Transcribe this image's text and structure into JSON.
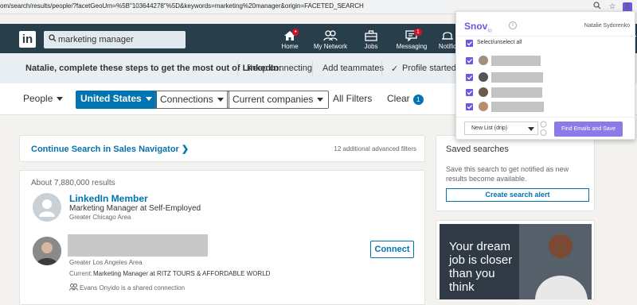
{
  "browser": {
    "url": "om/search/results/people/?facetGeoUrn=%5B\"103644278\"%5D&keywords=marketing%20manager&origin=FACETED_SEARCH",
    "icons": [
      "zoom-icon",
      "star-icon",
      "snovio-extension-icon"
    ],
    "ext_label": "S"
  },
  "nav": {
    "logo": "in",
    "search_value": "marketing manager",
    "items": [
      {
        "label": "Home",
        "badge": "•"
      },
      {
        "label": "My Network",
        "badge": ""
      },
      {
        "label": "Jobs",
        "badge": ""
      },
      {
        "label": "Messaging",
        "badge": "1"
      },
      {
        "label": "Notific",
        "badge": ""
      }
    ]
  },
  "steps": {
    "message": "Natalie, complete these steps to get the most out of LinkedIn:",
    "keep": "Keep connecting",
    "teammates": "Add teammates",
    "profile": "Profile started",
    "check": "✓"
  },
  "filters": {
    "people": "People",
    "country": "United States",
    "connections": "Connections",
    "companies": "Current companies",
    "all": "All Filters",
    "clear": "Clear",
    "clear_count": "1"
  },
  "sales_nav": {
    "link": "Continue Search in Sales Navigator ❯",
    "advanced": "12 additional advanced filters"
  },
  "results": {
    "count": "About 7,880,000 results",
    "items": [
      {
        "name": "LinkedIn Member",
        "headline": "Marketing Manager at Self-Employed",
        "location": "Greater Chicago Area"
      },
      {
        "location": "Greater Los Angeles Area",
        "current_prefix": "Current:",
        "current": "Marketing Manager at RITZ TOURS & AFFORDABLE WORLD",
        "shared": "Evans Onyido is a shared connection",
        "action": "Connect"
      }
    ]
  },
  "saved": {
    "title": "Saved searches",
    "text": "Save this search to get notified as new results become available.",
    "button": "Create search alert"
  },
  "ad": {
    "lines": [
      "Your dream",
      "job is closer",
      "than you",
      "think"
    ]
  },
  "snovio": {
    "brand": "Snov",
    "brand_sub": "io",
    "info": "i",
    "user": "Natalie Sydorenko",
    "select_all": "Select/unselect all",
    "list_value": "New List (drip)",
    "find_button": "Find Emails and Save",
    "accent": "#6c57e0"
  }
}
